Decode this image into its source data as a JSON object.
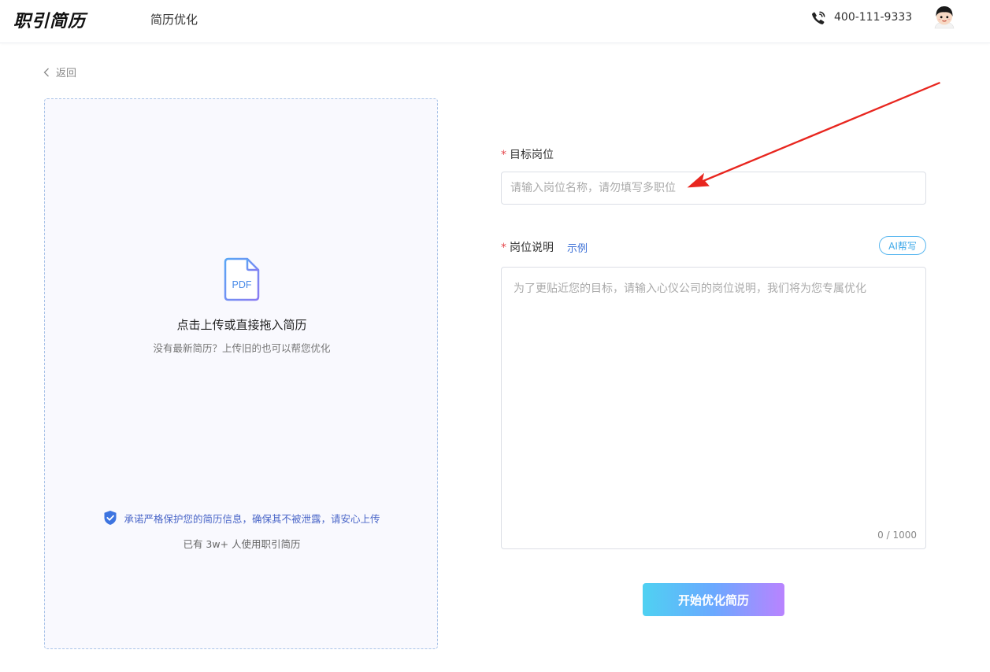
{
  "header": {
    "logo": "职引简历",
    "nav_item": "简历优化",
    "phone": "400-111-9333",
    "icons": {
      "phone": "phone-call-icon",
      "avatar": "user-avatar"
    }
  },
  "back": {
    "label": "返回",
    "icon": "chevron-left-icon"
  },
  "upload": {
    "title": "点击上传或直接拖入简历",
    "subtitle": "没有最新简历？上传旧的也可以帮您优化",
    "file_type": "PDF",
    "privacy": "承诺严格保护您的简历信息，确保其不被泄露，请安心上传",
    "users": "已有 3w+ 人使用职引简历",
    "icons": {
      "file": "pdf-file-icon",
      "privacy": "shield-check-icon"
    }
  },
  "form": {
    "required_mark": "*",
    "job": {
      "label": "目标岗位",
      "placeholder": "请输入岗位名称，请勿填写多职位",
      "value": ""
    },
    "desc": {
      "label": "岗位说明",
      "example": "示例",
      "ai_button": "AI帮写",
      "placeholder": "为了更贴近您的目标，请输入心仪公司的岗位说明，我们将为您专属优化",
      "value": "",
      "counter": "0 / 1000"
    },
    "submit": "开始优化简历"
  },
  "colors": {
    "accent_blue": "#3b6fd6",
    "required_red": "#e5484d",
    "button_gradient": [
      "#4fd1f2",
      "#6aa9ff",
      "#b983ff"
    ],
    "annotation_arrow": "#e8261f"
  }
}
